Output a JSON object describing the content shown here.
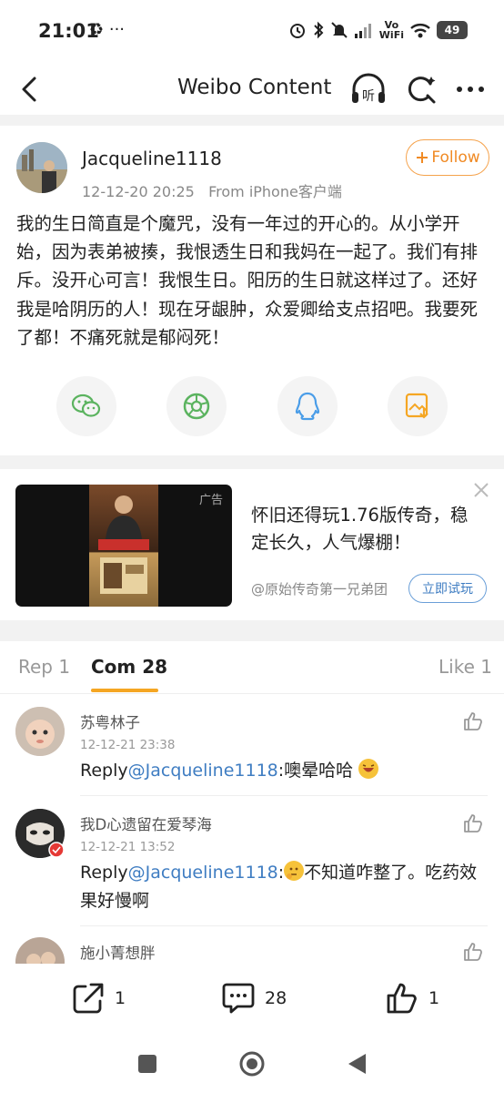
{
  "status_bar": {
    "time": "21:01",
    "left_icons": "♻ ···",
    "vowifi": "Vo\nWiFi",
    "battery": "49"
  },
  "nav": {
    "title": "Weibo Content"
  },
  "post": {
    "username": "Jacqueline1118",
    "time": "12-12-20 20:25",
    "source": "From iPhone客户端",
    "follow_label": "Follow",
    "text": "我的生日简直是个魔咒，没有一年过的开心的。从小学开始，因为表弟被揍，我恨透生日和我妈在一起了。我们有排斥。没开心可言！我恨生日。阳历的生日就这样过了。还好我是哈阴历的人！现在牙龈肿，众爱卿给支点招吧。我要死了都！不痛死就是郁闷死！"
  },
  "share": {
    "items": [
      "wechat-icon",
      "moments-icon",
      "qq-icon",
      "save-image-icon"
    ]
  },
  "ad": {
    "tag": "广告",
    "headline": "怀旧还得玩1.76版传奇，稳定长久，人气爆棚！",
    "source": "@原始传奇第一兄弟团",
    "cta": "立即试玩"
  },
  "tabs": {
    "repost": "Rep 1",
    "comments": "Com 28",
    "likes": "Like 1"
  },
  "comments": [
    {
      "name": "苏粤林子",
      "time": "12-12-21 23:38",
      "prefix": "Reply",
      "mention": "@Jacqueline1118",
      "text": ":噢晕哈哈"
    },
    {
      "name": "我D心遗留在爱琴海",
      "time": "12-12-21 13:52",
      "prefix": "Reply",
      "mention": "@Jacqueline1118",
      "text": ":",
      "text_after": "不知道咋整了。吃药效果好慢啊"
    },
    {
      "name": "施小菁想胖"
    }
  ],
  "bottom": {
    "reposts": "1",
    "comments": "28",
    "likes": "1"
  },
  "colors": {
    "accent_orange": "#f08a24",
    "link_blue": "#3f7dc2"
  }
}
